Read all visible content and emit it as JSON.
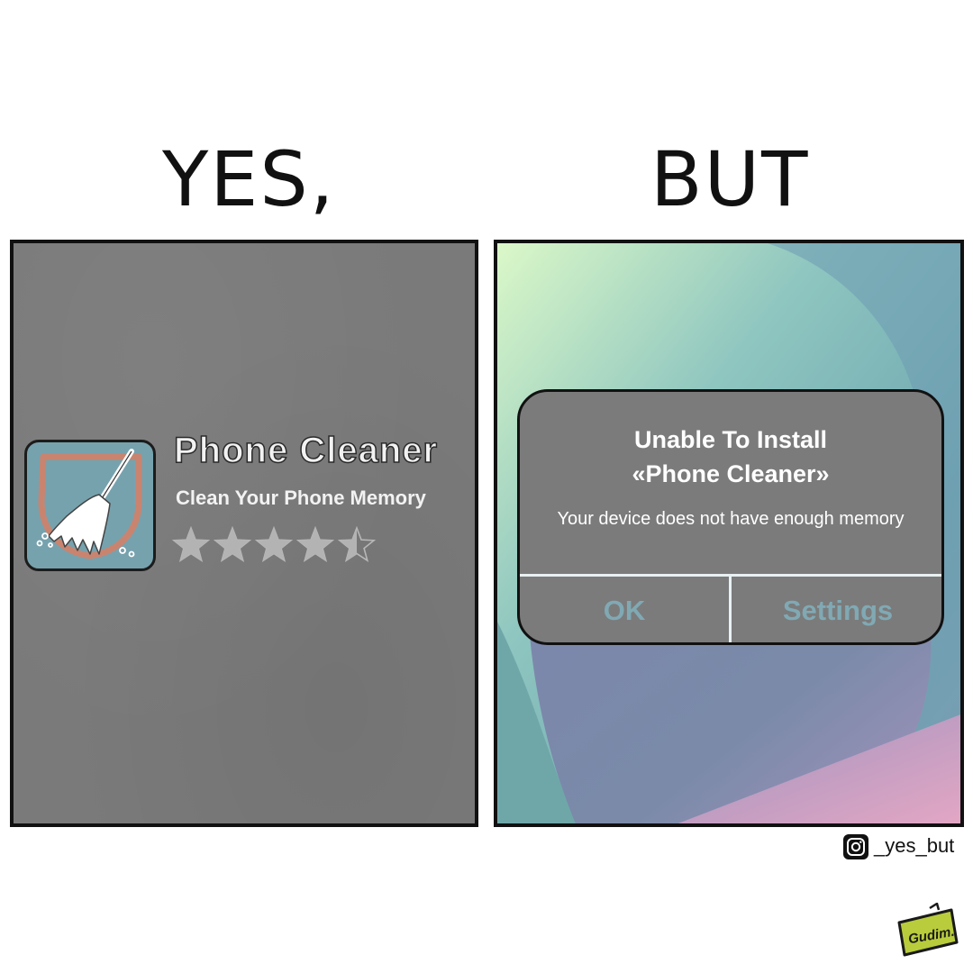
{
  "headings": {
    "left": "YES,",
    "right": "BUT"
  },
  "app_listing": {
    "icon": "broom-shield-icon",
    "title": "Phone Cleaner",
    "subtitle": "Clean Your Phone Memory",
    "rating": 4.5,
    "rating_max": 5
  },
  "install_dialog": {
    "title_line1": "Unable To Install",
    "title_line2": "«Phone Cleaner»",
    "message": "Your device does not have enough memory",
    "ok_label": "OK",
    "settings_label": "Settings"
  },
  "footer": {
    "instagram_icon": "instagram-icon",
    "handle": "_yes_but",
    "signature": "Gudim."
  },
  "colors": {
    "left_panel_bg": "#7a7a7a",
    "app_icon_bg": "#76a2ae",
    "shield_stroke": "#c98470",
    "dialog_bg": "#7b7b7b",
    "dialog_button_text": "#80a9b4",
    "signature_green": "#b9cc3c"
  }
}
